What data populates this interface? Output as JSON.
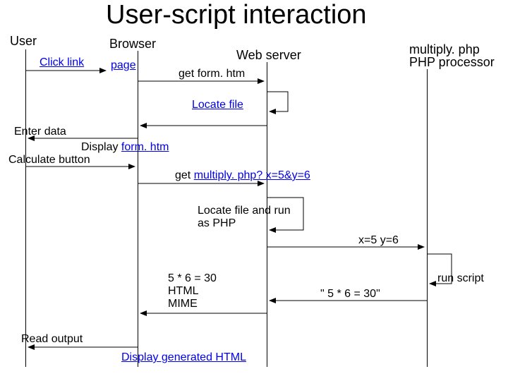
{
  "title": "User-script interaction",
  "lanes": {
    "user": "User",
    "browser": "Browser",
    "webserver": "Web server",
    "php1": "multiply. php",
    "php2": "PHP processor"
  },
  "labels": {
    "click_link": "Click link",
    "page": "page",
    "get_form": "get form. htm",
    "locate_file": "Locate file",
    "enter_data": "Enter data",
    "display_form_prefix": "Display ",
    "display_form_link": "form. htm",
    "calculate_button": "Calculate button",
    "get_multiply_prefix": "get ",
    "get_multiply_link": "multiply. php? x=5&y=6",
    "locate_run1": "Locate file and run",
    "locate_run2": "as PHP",
    "x5y6": "x=5 y=6",
    "calc1": "5 * 6 = 30",
    "calc2": "HTML",
    "calc3": "MIME",
    "result_str": "\" 5 * 6 = 30\"",
    "run_script": "run script",
    "read_output": "Read output",
    "display_gen": "Display generated HTML"
  }
}
